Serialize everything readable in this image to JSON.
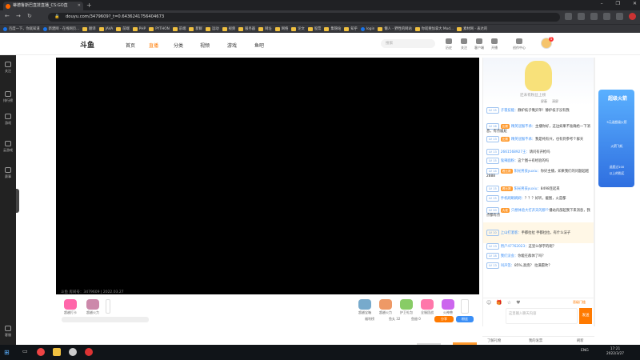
{
  "browser": {
    "tab_title": "蒂德鲁斯巴直技直播_CS:GO直",
    "url": "douyu.com/3479609?_t=0.6436241756404673",
    "bookmarks": [
      "百度一下，你就知道",
      "新建网 - 在线网页...",
      "翻译",
      "JAVA",
      "前端",
      "PHP",
      "PYTHON",
      "前端",
      "新鲜",
      "运动",
      "视频",
      "服务器",
      "网址",
      "网络",
      "论文",
      "股票",
      "集锦站",
      "知乎",
      "login",
      "懒人 - 野性的网站",
      "你就要加拿大 Mod...",
      "素材网 - 表达的"
    ],
    "new_tab": "+",
    "window_controls": [
      "–",
      "❐",
      "✕"
    ]
  },
  "site": {
    "logo_text": "斗鱼",
    "nav": [
      "首页",
      "直播",
      "分类",
      "视频",
      "游戏",
      "鱼吧"
    ],
    "search_placeholder": "搜索",
    "header_icons": [
      "历史",
      "关注",
      "客户端",
      "开播",
      "创作中心"
    ],
    "avatar_badge": "5"
  },
  "sidebar": {
    "items": [
      "关注",
      "排行榜",
      "游戏",
      "云游戏",
      "赛事"
    ],
    "bottom": "客服"
  },
  "player": {
    "overlay_text": "斗鱼 房间号：3479609 | 2022.03.27",
    "gifts": [
      "超越宝箱",
      "超越火力",
      "护卫礼包",
      "全服团战",
      "火神兽",
      "超级飞机",
      "超级火箭"
    ],
    "left_gifts": [
      "超越打卡",
      "超越火力"
    ],
    "counters": [
      "福利榜",
      "鱼丸 32",
      "鱼翅 0"
    ],
    "share_label": "分享",
    "fans_label": "粉丝"
  },
  "chat": {
    "title": "还未有粉丝上榜",
    "tools": [
      "屏蔽",
      "清屏"
    ],
    "messages": [
      {
        "lv": "LV 15",
        "name": "子夜技能：",
        "text": "静炉枝子俺买单！静炉枝子没有我"
      },
      {
        "lv": "LV 16",
        "badge": "比赛",
        "name": "精英冠猴不承：",
        "text": "主播你好，这边如果不准确给一下消息，有点尴尬"
      },
      {
        "lv": "LV 13",
        "badge": "比赛",
        "name": "精英冠猴不承：",
        "text": "我是纯有兴，也有到参考个群天"
      },
      {
        "lv": "LV 13",
        "name": "2661568927王：",
        "text": "请问有开枪吗"
      },
      {
        "lv": "LV 15",
        "name": "鬼辣面粉：",
        "text": "这个图十有经验的吗"
      },
      {
        "lv": "LV 14",
        "badge": "看比赛",
        "name": "阳光男孩yuxiu：",
        "text": "你好主播，如果我们的问题超越2888"
      },
      {
        "lv": "LV 15",
        "badge": "看比赛",
        "name": "阳光男孩yuxiu：",
        "text": "8498连起来"
      },
      {
        "lv": "LV 15",
        "name": "手机刷刷刷刷：",
        "text": "？？？好听，截图，火是都"
      },
      {
        "lv": "LV 20",
        "badge": "大佬",
        "name": "只想体验大打开天的那个",
        "text": "播站内部超我下来消息，我点都有点"
      },
      {
        "lv": "LV 10",
        "name": "上山打酒客：",
        "text": "手都拉拉 手都拉拉，有什么法子"
      },
      {
        "lv": "LV 13",
        "name": "用户47762023：",
        "text": "这里么够宇的呢？"
      },
      {
        "lv": "LV 18",
        "name": "我们没会：",
        "text": "你能在群体了吗？"
      },
      {
        "lv": "LV 13",
        "name": "叫声签：",
        "text": "85%,高烧？ 拉满雷吹？"
      }
    ],
    "input_placeholder": "这里输入聊天内容",
    "send_label": "发送",
    "rank_label": "晋级门槛"
  },
  "ad": {
    "title": "超级火箭",
    "lines": [
      "5元送超级火箭",
      "火箭飞机",
      "送超过100",
      "以上的购买"
    ]
  },
  "bottom_strip": {
    "left": "了解礼物",
    "mid": "我的发票",
    "right": "刷新"
  },
  "taskbar": {
    "lang": "ENG",
    "time": "17:21",
    "date": "2022/3/27"
  },
  "colors": {
    "accent": "#ff7a00",
    "blue": "#3a8ef6",
    "dark_sidebar": "#222222"
  }
}
